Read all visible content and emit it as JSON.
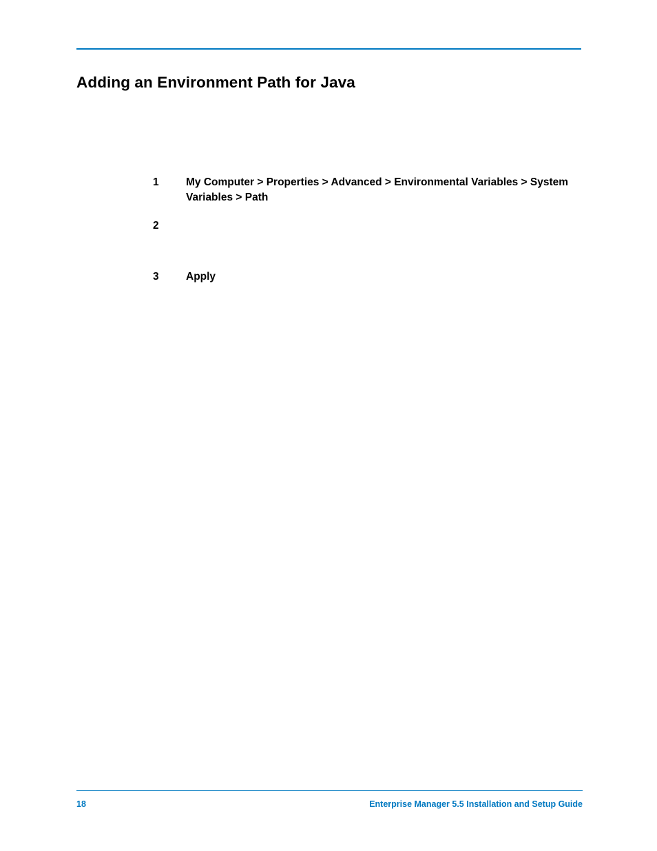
{
  "heading": "Adding an Environment Path for Java",
  "steps": {
    "s1": {
      "num": "1",
      "bold": "My Computer > Properties > Advanced > Environmental Variables > System Variables > Path"
    },
    "s2": {
      "num": "2"
    },
    "s3": {
      "num": "3",
      "bold": "Apply"
    }
  },
  "footer": {
    "page_number": "18",
    "title": "Enterprise Manager 5.5 Installation and Setup Guide"
  }
}
